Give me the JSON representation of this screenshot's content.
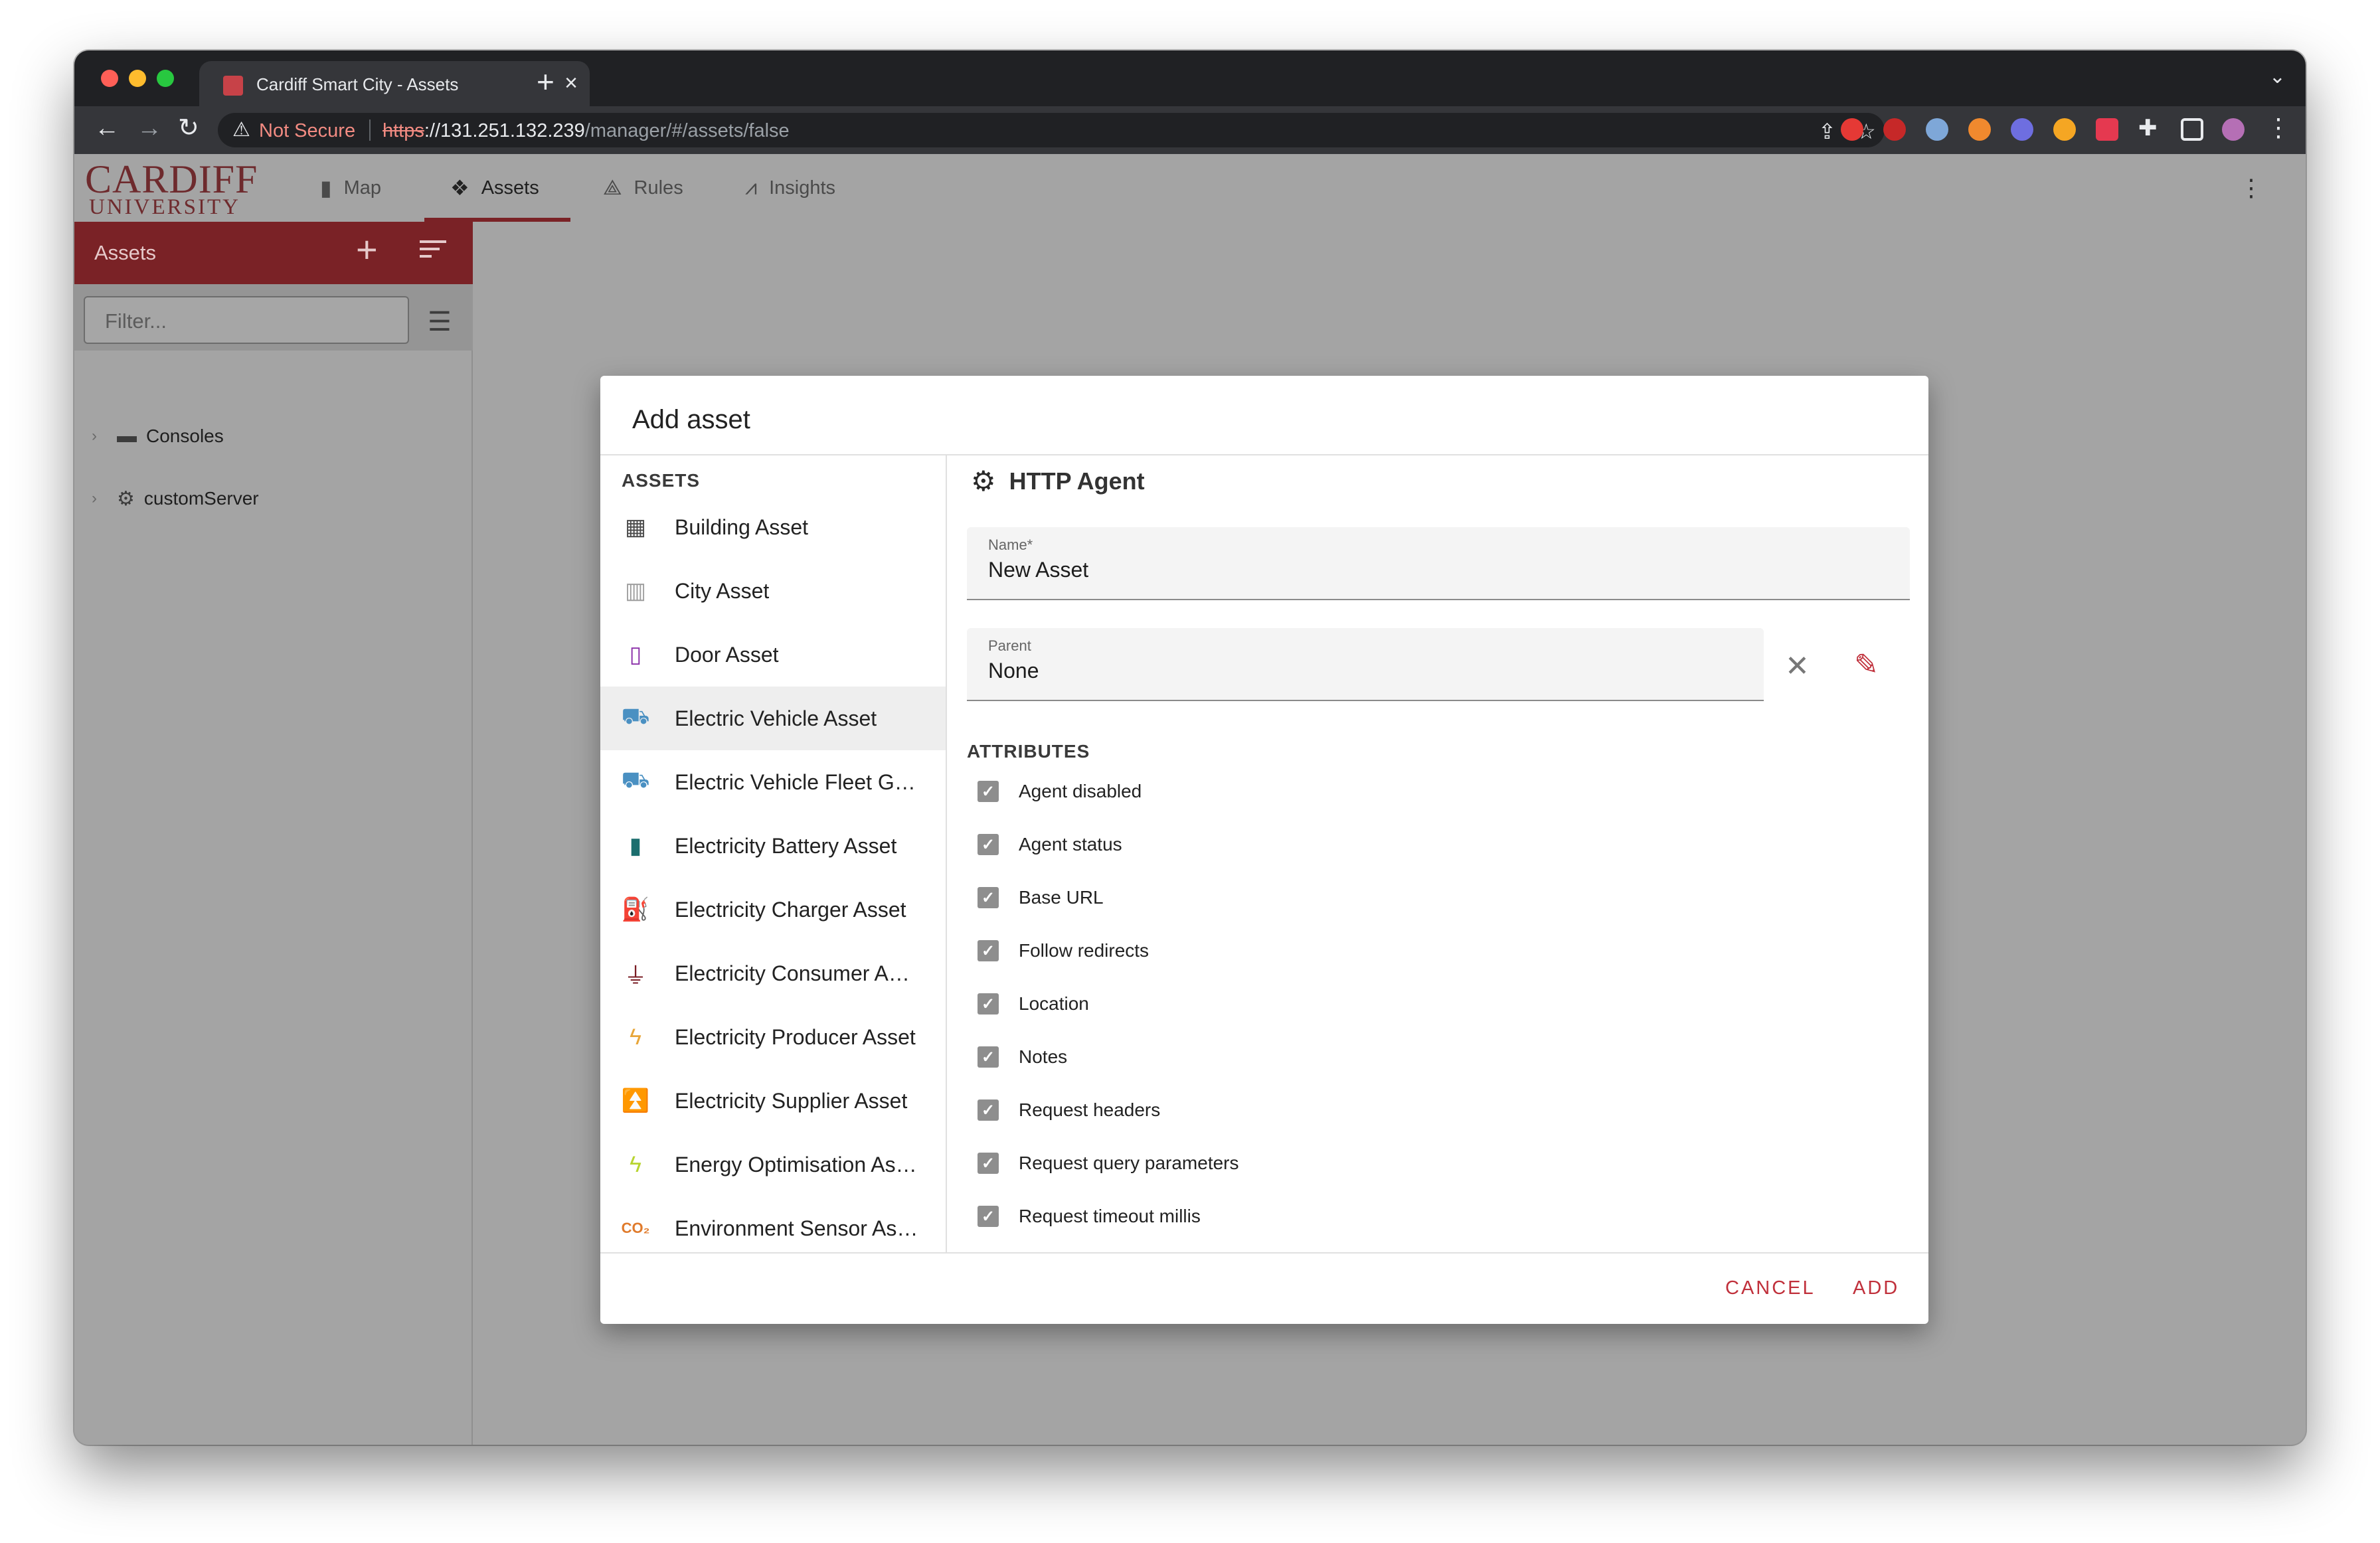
{
  "browser": {
    "tab_title": "Cardiff Smart City - Assets",
    "security_label": "Not Secure",
    "url_scheme": "https",
    "url_host": "://131.251.132.239",
    "url_path": "/manager/#/assets/false"
  },
  "app": {
    "logo_top": "CARDIFF",
    "logo_bottom": "UNIVERSITY",
    "nav": [
      {
        "label": "Map",
        "icon": "map-icon"
      },
      {
        "label": "Assets",
        "icon": "assets-icon"
      },
      {
        "label": "Rules",
        "icon": "rules-icon"
      },
      {
        "label": "Insights",
        "icon": "insights-icon"
      }
    ],
    "active_nav": "Assets"
  },
  "sidebar": {
    "title": "Assets",
    "filter_placeholder": "Filter...",
    "tree": [
      {
        "label": "Consoles",
        "icon": "folder-icon"
      },
      {
        "label": "customServer",
        "icon": "cogs-icon"
      }
    ]
  },
  "dialog": {
    "title": "Add asset",
    "assets_header": "ASSETS",
    "asset_types": [
      {
        "label": "Building Asset",
        "icon": "building-icon",
        "color": "#4a4a4a"
      },
      {
        "label": "City Asset",
        "icon": "city-icon",
        "color": "#9e9e9e"
      },
      {
        "label": "Door Asset",
        "icon": "door-icon",
        "color": "#8a2ea8"
      },
      {
        "label": "Electric Vehicle Asset",
        "icon": "car-icon",
        "color": "#4a90c2"
      },
      {
        "label": "Electric Vehicle Fleet G…",
        "icon": "car-multiple-icon",
        "color": "#4a90c2"
      },
      {
        "label": "Electricity Battery Asset",
        "icon": "battery-charging-icon",
        "color": "#1b6e6e"
      },
      {
        "label": "Electricity Charger Asset",
        "icon": "ev-station-icon",
        "color": "#8b1f2b"
      },
      {
        "label": "Electricity Consumer A…",
        "icon": "power-plug-icon",
        "color": "#7a1d24"
      },
      {
        "label": "Electricity Producer Asset",
        "icon": "flash-icon",
        "color": "#e8a63a"
      },
      {
        "label": "Electricity Supplier Asset",
        "icon": "transmission-tower-icon",
        "color": "#7a3b94"
      },
      {
        "label": "Energy Optimisation As…",
        "icon": "flash-icon",
        "color": "#b8d430"
      },
      {
        "label": "Environment Sensor As…",
        "icon": "co2-icon",
        "color": "#e07b2c"
      }
    ],
    "selected_asset": "Electric Vehicle Asset",
    "agent_title": "HTTP Agent",
    "name_label": "Name*",
    "name_value": "New Asset",
    "parent_label": "Parent",
    "parent_value": "None",
    "attributes_header": "ATTRIBUTES",
    "attributes": [
      "Agent disabled",
      "Agent status",
      "Base URL",
      "Follow redirects",
      "Location",
      "Notes",
      "Request headers",
      "Request query parameters",
      "Request timeout millis"
    ],
    "cancel_label": "CANCEL",
    "add_label": "ADD"
  },
  "colors": {
    "brand": "#7a2226",
    "accent": "#c0303b"
  }
}
